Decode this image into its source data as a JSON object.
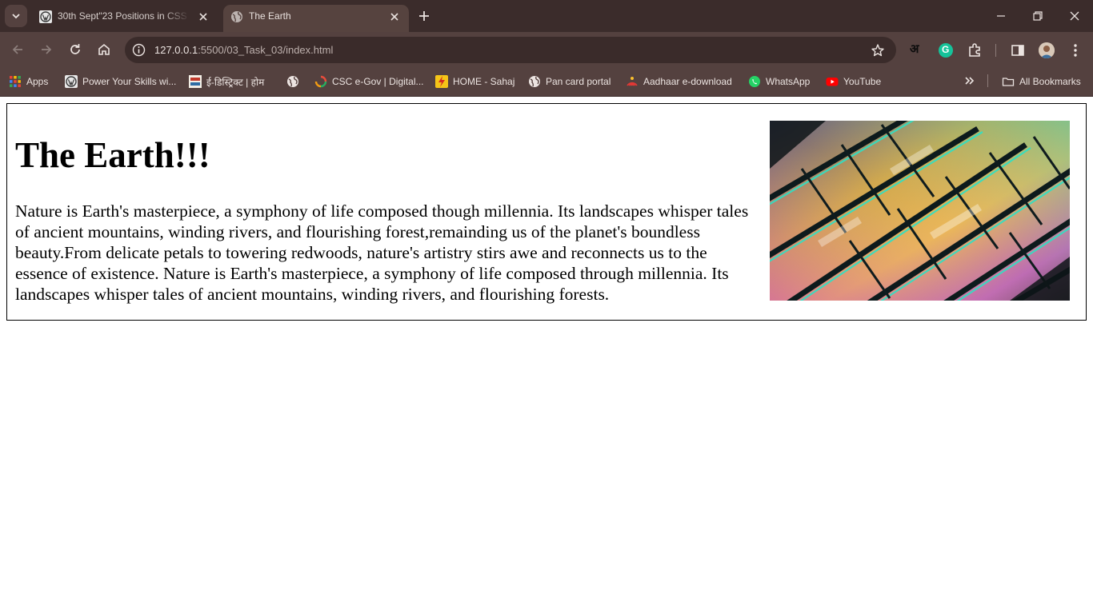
{
  "browser": {
    "tabs": [
      {
        "title": "30th Sept\"23 Positions in CSS - ",
        "active": false
      },
      {
        "title": "The Earth",
        "active": true
      }
    ],
    "url": {
      "host": "127.0.0.1",
      "path": ":5500/03_Task_03/index.html"
    },
    "translate_label": "अ",
    "grammarly_label": "G",
    "bookmarks": [
      {
        "label": "Apps",
        "icon": "apps-grid-icon"
      },
      {
        "label": "Power Your Skills wi...",
        "icon": "wordpress-icon"
      },
      {
        "label": "ई-डिस्ट्रिक्ट | होम",
        "icon": "edistrict-icon"
      },
      {
        "label": "",
        "icon": "globe-icon"
      },
      {
        "label": "CSC e-Gov | Digital...",
        "icon": "csc-icon"
      },
      {
        "label": "HOME - Sahaj",
        "icon": "sahaj-icon"
      },
      {
        "label": "Pan card portal",
        "icon": "globe-icon"
      },
      {
        "label": "Aadhaar e-download",
        "icon": "aadhaar-icon"
      },
      {
        "label": "WhatsApp",
        "icon": "whatsapp-icon"
      },
      {
        "label": "YouTube",
        "icon": "youtube-icon"
      }
    ],
    "all_bookmarks_label": "All Bookmarks"
  },
  "page": {
    "heading": "The Earth!!!",
    "paragraph": "Nature is Earth's masterpiece, a symphony of life composed though millennia. Its landscapes whisper tales of ancient mountains, winding rivers, and flourishing forest,remainding us of the planet's boundless beauty.From delicate petals to towering redwoods, nature's artistry stirs awe and reconnects us to the essence of existence. Nature is Earth's masterpiece, a symphony of life composed through millennia. Its landscapes whisper tales of ancient mountains, winding rivers, and flourishing forests."
  },
  "colors": {
    "frame": "#3b2c2b",
    "toolbar": "#54413f",
    "omnibox": "#3a2b2a"
  }
}
